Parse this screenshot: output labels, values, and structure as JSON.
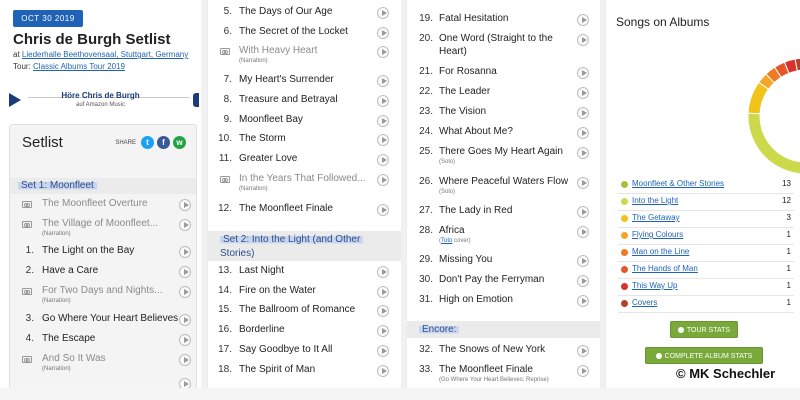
{
  "panel1": {
    "date_badge": "OCT 30 2019",
    "title": "Chris de Burgh Setlist",
    "venue_prefix": "at ",
    "venue_link": "Liederhalle Beethovensaal, Stuttgart, Germany",
    "tour_prefix": "Tour: ",
    "tour_link": "Classic Albums Tour 2019",
    "amazon_title": "Höre Chris de Burgh",
    "amazon_sub": "auf Amazon Music",
    "setlist_heading": "Setlist",
    "share_label": "SHARE",
    "social": {
      "twitter": "t",
      "facebook": "f",
      "whatsapp": "w"
    },
    "set1_heading": "Set 1: Moonfleet",
    "rows": [
      {
        "num": "",
        "title": "The Moonfleet Overture",
        "note": "",
        "tape": true
      },
      {
        "num": "",
        "title": "The Village of Moonfleet...",
        "note": "(Narration)",
        "tape": true
      },
      {
        "num": "1.",
        "title": "The Light on the Bay",
        "note": "",
        "tape": false
      },
      {
        "num": "2.",
        "title": "Have a Care",
        "note": "",
        "tape": false
      },
      {
        "num": "",
        "title": "For Two Days and Nights...",
        "note": "(Narration)",
        "tape": true
      },
      {
        "num": "3.",
        "title": "Go Where Your Heart Believes",
        "note": "",
        "tape": false
      },
      {
        "num": "4.",
        "title": "The Escape",
        "note": "",
        "tape": false
      },
      {
        "num": "",
        "title": "And So It Was",
        "note": "(Narration)",
        "tape": true
      },
      {
        "num": "",
        "title": "",
        "note": "",
        "tape": false
      }
    ]
  },
  "panel2": {
    "rows_a": [
      {
        "num": "5.",
        "title": "The Days of Our Age",
        "note": "",
        "tape": false
      },
      {
        "num": "6.",
        "title": "The Secret of the Locket",
        "note": "",
        "tape": false
      },
      {
        "num": "",
        "title": "With Heavy Heart",
        "note": "(Narration)",
        "tape": true
      },
      {
        "num": "7.",
        "title": "My Heart's Surrender",
        "note": "",
        "tape": false
      },
      {
        "num": "8.",
        "title": "Treasure and Betrayal",
        "note": "",
        "tape": false
      },
      {
        "num": "9.",
        "title": "Moonfleet Bay",
        "note": "",
        "tape": false
      },
      {
        "num": "10.",
        "title": "The Storm",
        "note": "",
        "tape": false
      },
      {
        "num": "11.",
        "title": "Greater Love",
        "note": "",
        "tape": false
      },
      {
        "num": "",
        "title": "In the Years That Followed...",
        "note": "(Narration)",
        "tape": true
      },
      {
        "num": "12.",
        "title": "The Moonfleet Finale",
        "note": "",
        "tape": false
      }
    ],
    "set2_heading_line1": "Set 2: Into the Light (and Other",
    "set2_heading_line2": "Stories)",
    "rows_b": [
      {
        "num": "13.",
        "title": "Last Night",
        "note": ""
      },
      {
        "num": "14.",
        "title": "Fire on the Water",
        "note": ""
      },
      {
        "num": "15.",
        "title": "The Ballroom of Romance",
        "note": ""
      },
      {
        "num": "16.",
        "title": "Borderline",
        "note": ""
      },
      {
        "num": "17.",
        "title": "Say Goodbye to It All",
        "note": ""
      },
      {
        "num": "18.",
        "title": "The Spirit of Man",
        "note": ""
      }
    ]
  },
  "panel3": {
    "rows_a": [
      {
        "num": "19.",
        "title": "Fatal Hesitation",
        "note": ""
      },
      {
        "num": "20.",
        "title": "One Word (Straight to the",
        "title2": "Heart)",
        "note": ""
      },
      {
        "num": "21.",
        "title": "For Rosanna",
        "note": ""
      },
      {
        "num": "22.",
        "title": "The Leader",
        "note": ""
      },
      {
        "num": "23.",
        "title": "The Vision",
        "note": ""
      },
      {
        "num": "24.",
        "title": "What About Me?",
        "note": ""
      },
      {
        "num": "25.",
        "title": "There Goes My Heart Again",
        "note": "(Solo)"
      },
      {
        "num": "26.",
        "title": "Where Peaceful Waters Flow",
        "note": "(Solo)"
      },
      {
        "num": "27.",
        "title": "The Lady in Red",
        "note": ""
      },
      {
        "num": "28.",
        "title": "Africa",
        "note_link": "Toto",
        "note_rest": " cover)",
        "note_open": "("
      },
      {
        "num": "29.",
        "title": "Missing You",
        "note": ""
      },
      {
        "num": "30.",
        "title": "Don't Pay the Ferryman",
        "note": ""
      },
      {
        "num": "31.",
        "title": "High on Emotion",
        "note": ""
      }
    ],
    "encore_heading": "Encore:",
    "rows_b": [
      {
        "num": "32.",
        "title": "The Snows of New York",
        "note": ""
      },
      {
        "num": "33.",
        "title": "The Moonfleet Finale",
        "note": "(Go Where Your Heart Believes: Reprise)"
      }
    ]
  },
  "panel4": {
    "title": "Songs on Albums",
    "albums": [
      {
        "name": "Moonfleet & Other Stories",
        "count": 13,
        "color": "#a3c43a"
      },
      {
        "name": "Into the Light",
        "count": 12,
        "color": "#cbd94b"
      },
      {
        "name": "The Getaway",
        "count": 3,
        "color": "#f2c318"
      },
      {
        "name": "Flying Colours",
        "count": 1,
        "color": "#f4a52a"
      },
      {
        "name": "Man on the Line",
        "count": 1,
        "color": "#ee7a23"
      },
      {
        "name": "The Hands of Man",
        "count": 1,
        "color": "#e5562b"
      },
      {
        "name": "This Way Up",
        "count": 1,
        "color": "#d9312e"
      },
      {
        "name": "Covers",
        "count": 1,
        "color": "#b5402a"
      }
    ],
    "tour_stats_label": "TOUR STATS",
    "album_stats_label": "COMPLETE ALBUM STATS"
  },
  "copyright": "© MK Schechler"
}
